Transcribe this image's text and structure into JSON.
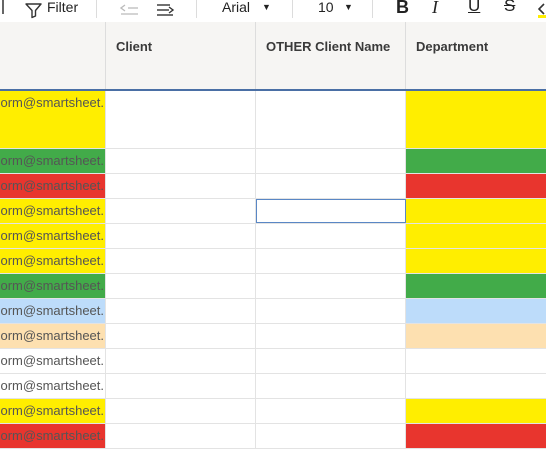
{
  "toolbar": {
    "filter_label": "Filter",
    "font_name": "Arial",
    "font_size": "10"
  },
  "columns": {
    "client": "Client",
    "other_client_name": "OTHER Client Name",
    "department": "Department"
  },
  "colors": {
    "yellow": "#ffee00",
    "green": "#42ab49",
    "red": "#e8352e",
    "light_blue": "#bddcfa",
    "peach": "#fde0b0",
    "white": "#ffffff"
  },
  "rows": [
    {
      "email": "orm@smartsheet.",
      "color": "yellow"
    },
    {
      "email": "orm@smartsheet.",
      "color": "green"
    },
    {
      "email": "orm@smartsheet.",
      "color": "red"
    },
    {
      "email": "orm@smartsheet.",
      "color": "yellow"
    },
    {
      "email": "orm@smartsheet.",
      "color": "yellow"
    },
    {
      "email": "orm@smartsheet.",
      "color": "yellow"
    },
    {
      "email": "orm@smartsheet.",
      "color": "green"
    },
    {
      "email": "orm@smartsheet.",
      "color": "light_blue"
    },
    {
      "email": "orm@smartsheet.",
      "color": "peach"
    },
    {
      "email": "orm@smartsheet.",
      "color": "white"
    },
    {
      "email": "orm@smartsheet.",
      "color": "white"
    },
    {
      "email": "orm@smartsheet.",
      "color": "yellow"
    },
    {
      "email": "orm@smartsheet.",
      "color": "red"
    }
  ]
}
